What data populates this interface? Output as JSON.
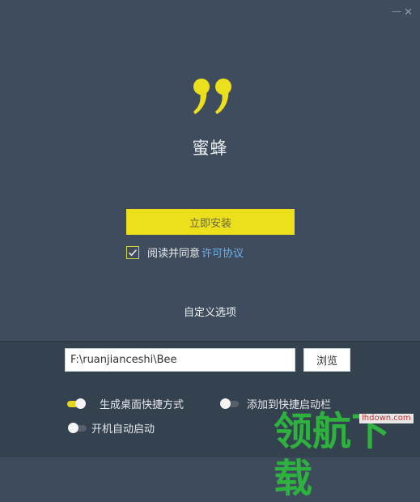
{
  "window": {
    "minimize_glyph": "—",
    "close_glyph": "✕"
  },
  "app": {
    "name": "蜜蜂",
    "logo_icon": "quote-mark-icon",
    "accent_color": "#ECDF1B"
  },
  "install": {
    "button_label": "立即安装"
  },
  "agreement": {
    "checked": true,
    "text": "阅读并同意",
    "link_label": "许可协议"
  },
  "custom_options": {
    "label": "自定义选项"
  },
  "path": {
    "value": "F:\\ruanjianceshi\\Bee",
    "browse_label": "浏览"
  },
  "options": {
    "desktop_shortcut": {
      "label": "生成桌面快捷方式",
      "on": true
    },
    "quick_launch": {
      "label": "添加到快捷启动栏",
      "on": false
    },
    "autostart": {
      "label": "开机自动启动",
      "on": false
    }
  },
  "watermark": {
    "text": "领航下载",
    "url": "lhdown.com"
  }
}
